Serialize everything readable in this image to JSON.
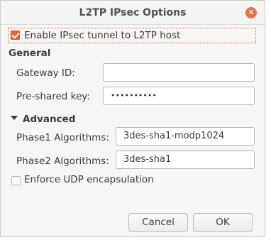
{
  "window": {
    "title": "L2TP IPsec Options",
    "close_icon": "close-icon"
  },
  "enable_ipsec": {
    "label": "Enable IPsec tunnel to L2TP host",
    "checked": true
  },
  "general": {
    "heading": "General",
    "gateway_id_label": "Gateway ID:",
    "gateway_id_value": "",
    "preshared_key_label": "Pre-shared key:",
    "preshared_key_value": "••••••••••"
  },
  "advanced": {
    "heading": "Advanced",
    "expanded": true,
    "phase1_label": "Phase1 Algorithms:",
    "phase1_value": "3des-sha1-modp1024",
    "phase2_label": "Phase2 Algorithms:",
    "phase2_value": "3des-sha1",
    "enforce_udp_label": "Enforce UDP encapsulation",
    "enforce_udp_checked": false
  },
  "buttons": {
    "cancel": "Cancel",
    "ok": "OK"
  },
  "colors": {
    "accent": "#e0673a",
    "close": "#e4764a"
  }
}
